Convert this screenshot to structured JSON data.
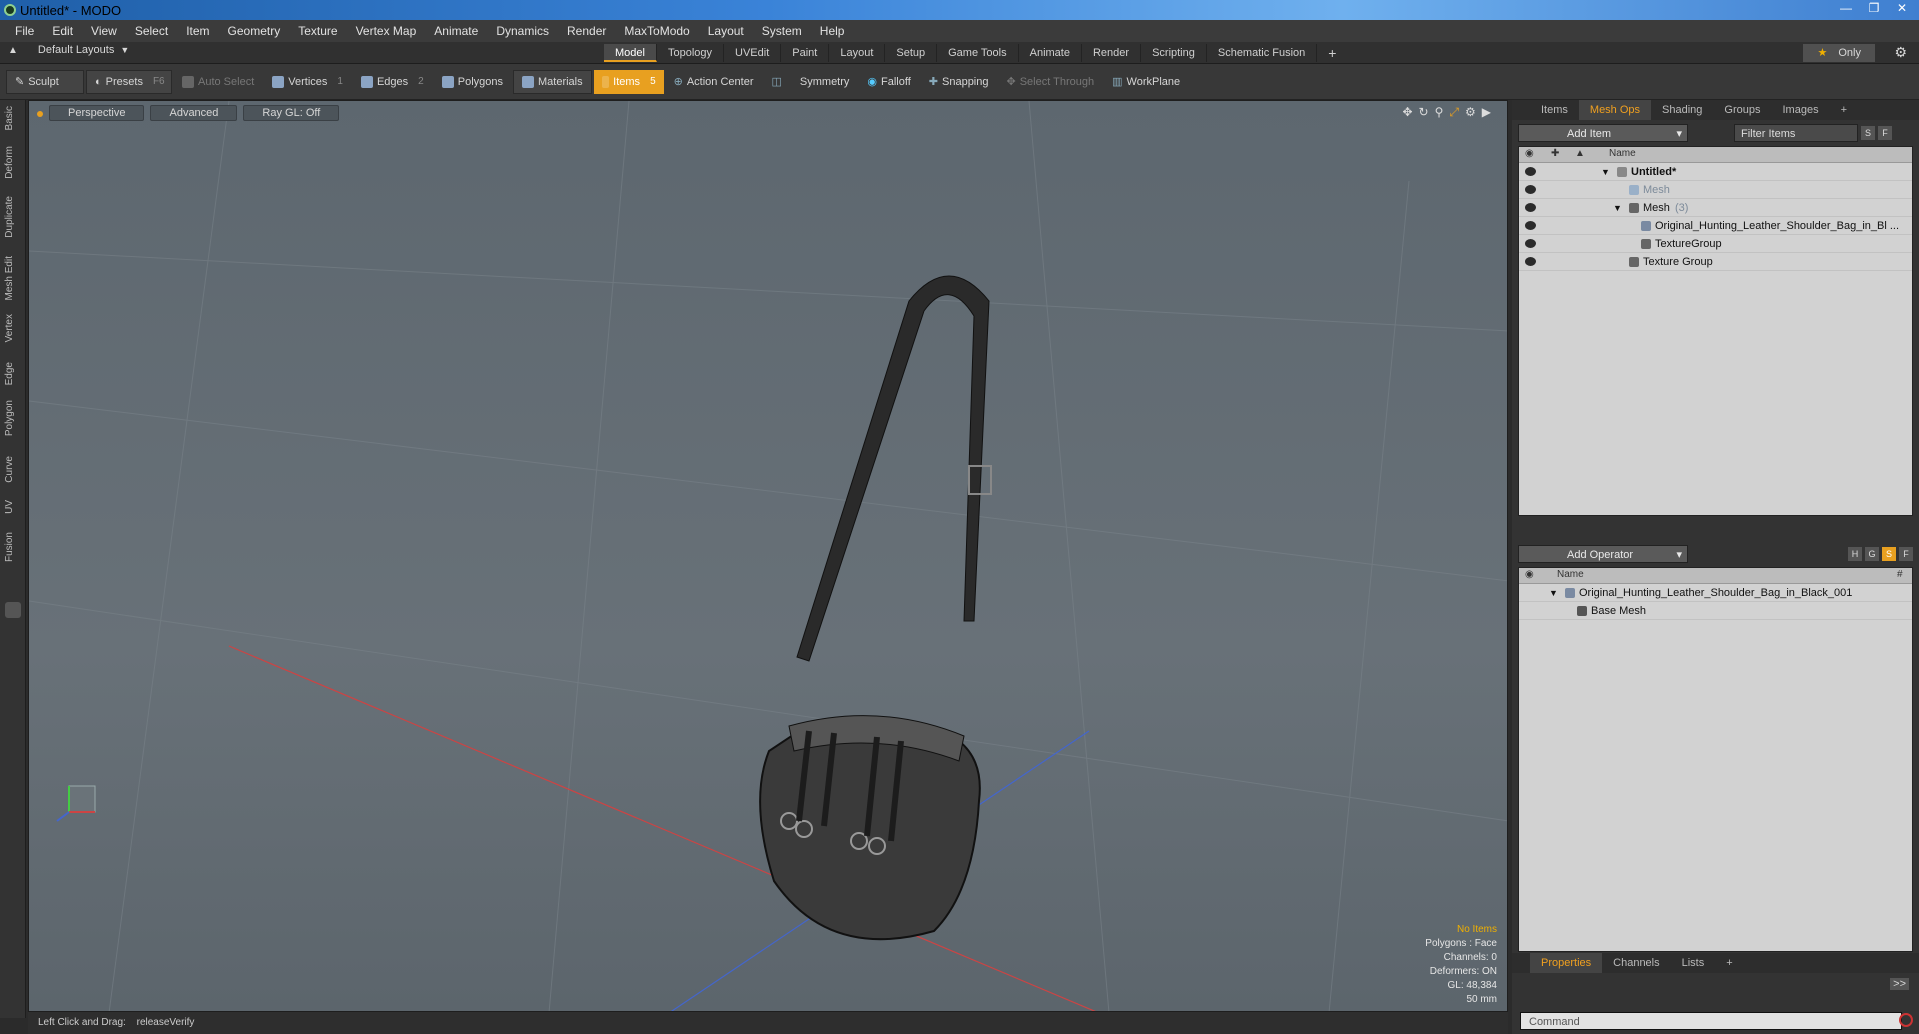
{
  "window": {
    "title": "Untitled* - MODO"
  },
  "menu": [
    "File",
    "Edit",
    "View",
    "Select",
    "Item",
    "Geometry",
    "Texture",
    "Vertex Map",
    "Animate",
    "Dynamics",
    "Render",
    "MaxToModo",
    "Layout",
    "System",
    "Help"
  ],
  "layout_selector": "Default Layouts",
  "tabs": [
    "Model",
    "Topology",
    "UVEdit",
    "Paint",
    "Layout",
    "Setup",
    "Game Tools",
    "Animate",
    "Render",
    "Scripting",
    "Schematic Fusion"
  ],
  "active_tab": "Model",
  "only_label": "Only",
  "toolbar": {
    "sculpt": "Sculpt",
    "presets": "Presets",
    "presets_key": "F6",
    "auto_select": "Auto Select",
    "vertices": "Vertices",
    "vertices_key": "1",
    "edges": "Edges",
    "edges_key": "2",
    "polygons": "Polygons",
    "materials": "Materials",
    "items": "Items",
    "items_key": "5",
    "action_center": "Action Center",
    "symmetry": "Symmetry",
    "falloff": "Falloff",
    "snapping": "Snapping",
    "select_through": "Select Through",
    "workplane": "WorkPlane"
  },
  "left_tabs": [
    "Basic",
    "Deform",
    "Duplicate",
    "Mesh Edit",
    "Vertex",
    "Edge",
    "Polygon",
    "Curve",
    "UV",
    "Fusion"
  ],
  "viewport": {
    "perspective": "Perspective",
    "advanced": "Advanced",
    "raygl": "Ray GL: Off",
    "info": {
      "no_items": "No Items",
      "polygons": "Polygons : Face",
      "channels": "Channels: 0",
      "deformers": "Deformers: ON",
      "gl": "GL: 48,384",
      "scale": "50 mm"
    }
  },
  "status": {
    "hint": "Left Click and Drag:",
    "action": "releaseVerify"
  },
  "items_panel": {
    "tabs": [
      "Items",
      "Mesh Ops",
      "Shading",
      "Groups",
      "Images"
    ],
    "active": "Mesh Ops",
    "add_item": "Add Item",
    "filter": "Filter Items",
    "col_name": "Name",
    "tree": {
      "scene": "Untitled*",
      "mesh_dim": "Mesh",
      "mesh_group": "Mesh",
      "mesh_count": "(3)",
      "mesh_item": "Original_Hunting_Leather_Shoulder_Bag_in_Bl ...",
      "texture_group_1": "TextureGroup",
      "texture_group_2": "Texture Group"
    }
  },
  "ops_panel": {
    "add_operator": "Add Operator",
    "col_name": "Name",
    "col_hash": "#",
    "root": "Original_Hunting_Leather_Shoulder_Bag_in_Black_001",
    "child": "Base Mesh"
  },
  "bottom_panel": {
    "tabs": [
      "Properties",
      "Channels",
      "Lists"
    ],
    "active": "Properties",
    "command_placeholder": "Command"
  }
}
